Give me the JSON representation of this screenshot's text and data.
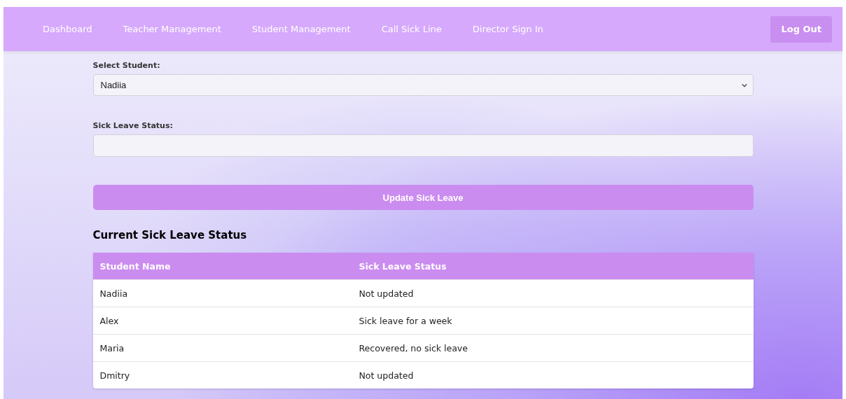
{
  "nav": {
    "links": [
      {
        "label": "Dashboard"
      },
      {
        "label": "Teacher Management"
      },
      {
        "label": "Student Management"
      },
      {
        "label": "Call Sick Line"
      },
      {
        "label": "Director Sign In"
      }
    ],
    "logout": "Log Out"
  },
  "form": {
    "student_label": "Select Student:",
    "student_value": "Nadiia",
    "status_label": "Sick Leave Status:",
    "submit": "Update Sick Leave"
  },
  "table": {
    "title": "Current Sick Leave Status",
    "columns": [
      "Student Name",
      "Sick Leave Status"
    ],
    "rows": [
      [
        "Nadiia",
        "Not updated"
      ],
      [
        "Alex",
        "Sick leave for a week"
      ],
      [
        "Maria",
        "Recovered, no sick leave"
      ],
      [
        "Dmitry",
        "Not updated"
      ]
    ]
  }
}
